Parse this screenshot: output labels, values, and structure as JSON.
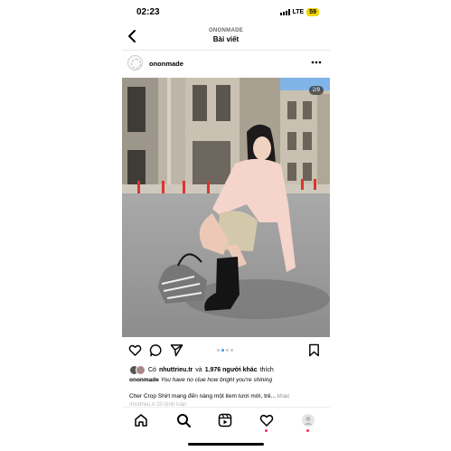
{
  "status": {
    "time": "02:23",
    "network": "LTE",
    "battery": "59"
  },
  "header": {
    "account": "ONONMADE",
    "title": "Bài viết"
  },
  "post": {
    "username": "ononmade",
    "image_counter": "2/9",
    "carousel": {
      "total_dots": 4,
      "active_index": 1
    },
    "likes": {
      "prefix": "Có",
      "user": "nhuttrieu.tr",
      "connector": "và",
      "others": "1.976 người khác",
      "suffix": "thích"
    },
    "caption_user": "ononmade",
    "caption_text": "You have no clue how bright you're shining",
    "description": "Cher Crop Shirt mang đến nàng một item tươi mới, trẻ...",
    "description_more": "khác",
    "partial_next_line": "nhuttrieu.tr 20 bình luận"
  },
  "icons": {
    "back": "chevron-left-icon",
    "more": "more-horizontal-icon",
    "like": "heart-icon",
    "comment": "comment-icon",
    "share": "send-icon",
    "save": "bookmark-icon"
  },
  "tabbar": [
    "home-icon",
    "search-icon",
    "reels-icon",
    "activity-heart-icon",
    "profile-avatar-icon"
  ],
  "colors": {
    "accent": "#3897f0",
    "notification": "#ff2d55",
    "battery": "#f2d500"
  }
}
